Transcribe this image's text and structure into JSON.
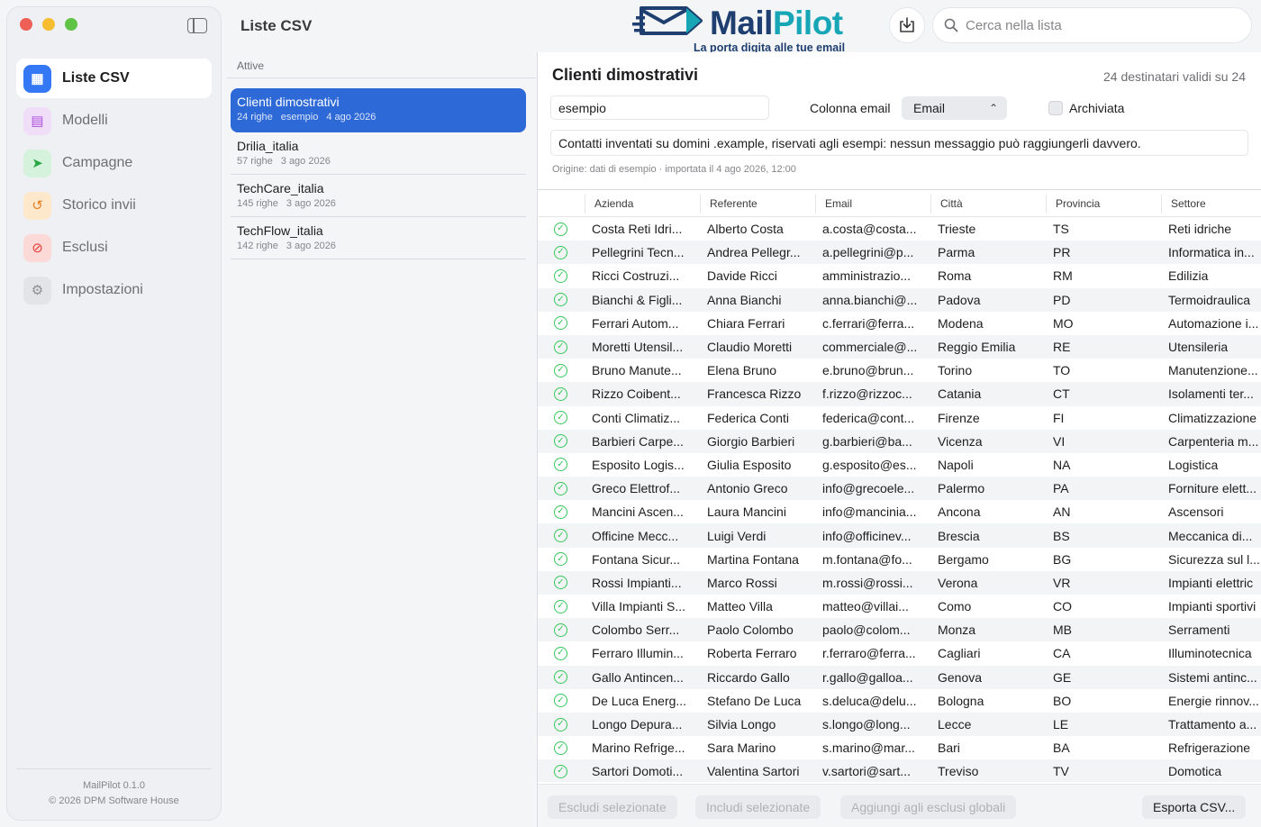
{
  "sidebar": {
    "items": [
      {
        "label": "Liste CSV",
        "icon": "table-icon",
        "color": "#3478f6",
        "bg": "#3478f6",
        "fg": "#ffffff",
        "active": true
      },
      {
        "label": "Modelli",
        "icon": "template-icon",
        "color": "#af52de",
        "bg": "#f0ddf7",
        "fg": "#af52de",
        "active": false
      },
      {
        "label": "Campagne",
        "icon": "paperplane-icon",
        "color": "#34c759",
        "bg": "#d5f2dc",
        "fg": "#28a745",
        "active": false
      },
      {
        "label": "Storico invii",
        "icon": "history-icon",
        "color": "#ff9500",
        "bg": "#fde8cc",
        "fg": "#e67e22",
        "active": false
      },
      {
        "label": "Esclusi",
        "icon": "prohibited-icon",
        "color": "#ff3b30",
        "bg": "#fbd9d7",
        "fg": "#e53935",
        "active": false
      },
      {
        "label": "Impostazioni",
        "icon": "gear-icon",
        "color": "#8e8e93",
        "bg": "#e3e4e8",
        "fg": "#8e8e93",
        "active": false
      }
    ],
    "footer_version": "MailPilot 0.1.0",
    "footer_copyright": "© 2026 DPM Software House"
  },
  "header": {
    "title": "Liste CSV",
    "logo_mail": "Mail",
    "logo_pilot": "Pilot",
    "logo_tagline": "La porta digita alle tue email",
    "search_placeholder": "Cerca nella lista"
  },
  "lists": {
    "section_label": "Attive",
    "items": [
      {
        "name": "Clienti dimostrativi",
        "rows": "24 righe",
        "tag": "esempio",
        "date": "4 ago 2026",
        "selected": true
      },
      {
        "name": "Drilia_italia",
        "rows": "57 righe",
        "tag": "",
        "date": "3 ago 2026",
        "selected": false
      },
      {
        "name": "TechCare_italia",
        "rows": "145 righe",
        "tag": "",
        "date": "3 ago 2026",
        "selected": false
      },
      {
        "name": "TechFlow_italia",
        "rows": "142 righe",
        "tag": "",
        "date": "3 ago 2026",
        "selected": false
      }
    ]
  },
  "detail": {
    "title": "Clienti dimostrativi",
    "count": "24 destinatari validi su 24",
    "tag_value": "esempio",
    "email_column_label": "Colonna email",
    "email_column_value": "Email",
    "archived_label": "Archiviata",
    "note": "Contatti inventati su domini .example, riservati agli esempi: nessun messaggio può raggiungerli davvero.",
    "origin": "Origine: dati di esempio · importata il 4 ago 2026, 12:00",
    "columns": [
      "Azienda",
      "Referente",
      "Email",
      "Città",
      "Provincia",
      "Settore"
    ],
    "rows": [
      [
        "Costa Reti Idri...",
        "Alberto Costa",
        "a.costa@costa...",
        "Trieste",
        "TS",
        "Reti idriche"
      ],
      [
        "Pellegrini Tecn...",
        "Andrea Pellegr...",
        "a.pellegrini@p...",
        "Parma",
        "PR",
        "Informatica in..."
      ],
      [
        "Ricci Costruzi...",
        "Davide Ricci",
        "amministrazio...",
        "Roma",
        "RM",
        "Edilizia"
      ],
      [
        "Bianchi & Figli...",
        "Anna Bianchi",
        "anna.bianchi@...",
        "Padova",
        "PD",
        "Termoidraulica"
      ],
      [
        "Ferrari Autom...",
        "Chiara Ferrari",
        "c.ferrari@ferra...",
        "Modena",
        "MO",
        "Automazione i..."
      ],
      [
        "Moretti Utensil...",
        "Claudio Moretti",
        "commerciale@...",
        "Reggio Emilia",
        "RE",
        "Utensileria"
      ],
      [
        "Bruno Manute...",
        "Elena Bruno",
        "e.bruno@brun...",
        "Torino",
        "TO",
        "Manutenzione..."
      ],
      [
        "Rizzo Coibent...",
        "Francesca Rizzo",
        "f.rizzo@rizzoc...",
        "Catania",
        "CT",
        "Isolamenti ter..."
      ],
      [
        "Conti Climatiz...",
        "Federica Conti",
        "federica@cont...",
        "Firenze",
        "FI",
        "Climatizzazione"
      ],
      [
        "Barbieri Carpe...",
        "Giorgio Barbieri",
        "g.barbieri@ba...",
        "Vicenza",
        "VI",
        "Carpenteria m..."
      ],
      [
        "Esposito Logis...",
        "Giulia Esposito",
        "g.esposito@es...",
        "Napoli",
        "NA",
        "Logistica"
      ],
      [
        "Greco Elettrof...",
        "Antonio Greco",
        "info@grecoele...",
        "Palermo",
        "PA",
        "Forniture elett..."
      ],
      [
        "Mancini Ascen...",
        "Laura Mancini",
        "info@mancinia...",
        "Ancona",
        "AN",
        "Ascensori"
      ],
      [
        "Officine Mecc...",
        "Luigi Verdi",
        "info@officinev...",
        "Brescia",
        "BS",
        "Meccanica di..."
      ],
      [
        "Fontana Sicur...",
        "Martina Fontana",
        "m.fontana@fo...",
        "Bergamo",
        "BG",
        "Sicurezza sul l..."
      ],
      [
        "Rossi Impianti...",
        "Marco Rossi",
        "m.rossi@rossi...",
        "Verona",
        "VR",
        "Impianti elettric"
      ],
      [
        "Villa Impianti S...",
        "Matteo Villa",
        "matteo@villai...",
        "Como",
        "CO",
        "Impianti sportivi"
      ],
      [
        "Colombo Serr...",
        "Paolo Colombo",
        "paolo@colom...",
        "Monza",
        "MB",
        "Serramenti"
      ],
      [
        "Ferraro Illumin...",
        "Roberta Ferraro",
        "r.ferraro@ferra...",
        "Cagliari",
        "CA",
        "Illuminotecnica"
      ],
      [
        "Gallo Antincen...",
        "Riccardo Gallo",
        "r.gallo@galloa...",
        "Genova",
        "GE",
        "Sistemi antinc..."
      ],
      [
        "De Luca Energ...",
        "Stefano De Luca",
        "s.deluca@delu...",
        "Bologna",
        "BO",
        "Energie rinnov..."
      ],
      [
        "Longo Depura...",
        "Silvia Longo",
        "s.longo@long...",
        "Lecce",
        "LE",
        "Trattamento a..."
      ],
      [
        "Marino Refrige...",
        "Sara Marino",
        "s.marino@mar...",
        "Bari",
        "BA",
        "Refrigerazione"
      ],
      [
        "Sartori Domoti...",
        "Valentina Sartori",
        "v.sartori@sart...",
        "Treviso",
        "TV",
        "Domotica"
      ]
    ],
    "footer_buttons": {
      "exclude_selected": "Escludi selezionate",
      "include_selected": "Includi selezionate",
      "add_global": "Aggiungi agli esclusi globali",
      "export": "Esporta CSV..."
    }
  }
}
